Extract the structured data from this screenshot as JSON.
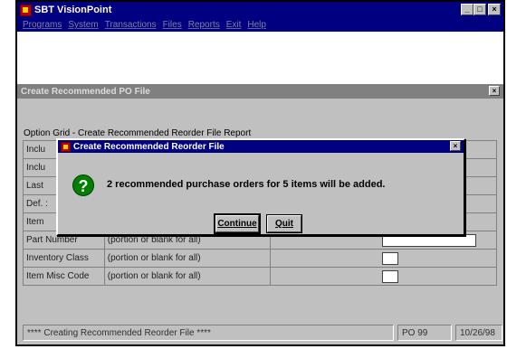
{
  "app": {
    "title": "SBT VisionPoint",
    "window_controls": [
      "_",
      "□",
      "×"
    ]
  },
  "menu": [
    "Programs",
    "System",
    "Transactions",
    "Files",
    "Reports",
    "Exit",
    "Help"
  ],
  "child_window": {
    "title": "Create Recommended PO File",
    "close": "×",
    "option_grid_label": "Option Grid - Create Recommended Reorder File Report",
    "rows": [
      {
        "label": "Inclu",
        "hint": ""
      },
      {
        "label": "Inclu",
        "hint": ""
      },
      {
        "label": "Last",
        "hint": ""
      },
      {
        "label": "Def. :",
        "hint": ""
      },
      {
        "label": "Item",
        "hint": ""
      },
      {
        "label": "Part Number",
        "hint": "(portion or blank for all)"
      },
      {
        "label": "Inventory Class",
        "hint": "(portion or blank for all)"
      },
      {
        "label": "Item Misc Code",
        "hint": "(portion or blank for all)"
      }
    ]
  },
  "dialog": {
    "title": "Create Recommended Reorder File",
    "close": "×",
    "icon": "question-icon",
    "message": "2 recommended purchase orders for 5 items will be added.",
    "continue_label": "Continue",
    "quit_label": "Quit"
  },
  "status": {
    "message": "**** Creating Recommended Reorder File ****",
    "module": "PO  99",
    "date": "10/26/98"
  }
}
